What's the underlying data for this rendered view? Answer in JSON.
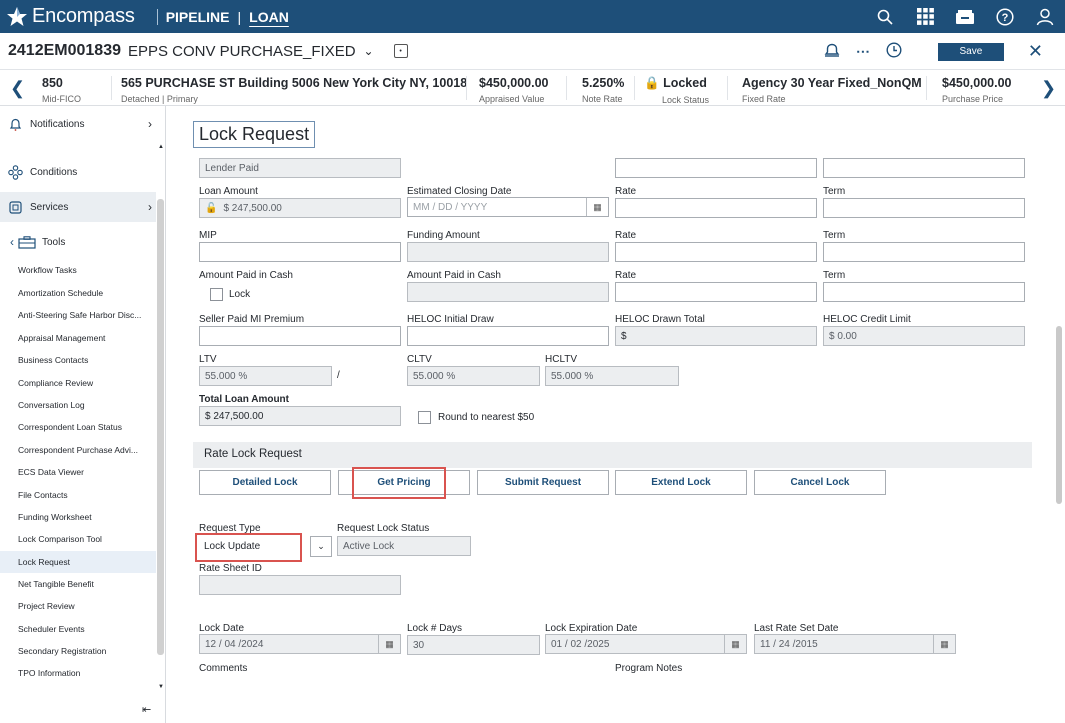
{
  "app": {
    "name": "Encompass",
    "nav_pipeline": "PIPELINE",
    "nav_loan": "LOAN"
  },
  "loan": {
    "number": "2412EM001839",
    "name": "EPPS CONV PURCHASE_FIXED",
    "save_label": "Save"
  },
  "strip": [
    {
      "value": "850",
      "label": "Mid-FICO"
    },
    {
      "value": "565 PURCHASE ST Building 5006 New York City NY, 10018",
      "label": "Detached | Primary"
    },
    {
      "value": "$450,000.00",
      "label": "Appraised Value"
    },
    {
      "value": "5.250%",
      "label": "Note Rate"
    },
    {
      "value": "Locked",
      "label": "Lock Status"
    },
    {
      "value": "Agency 30 Year Fixed_NonQM",
      "label": "Fixed Rate"
    },
    {
      "value": "$450,000.00",
      "label": "Purchase Price"
    }
  ],
  "sidebar": {
    "notifications": "Notifications",
    "conditions": "Conditions",
    "services": "Services",
    "tools": "Tools",
    "tool_items": [
      "Workflow Tasks",
      "Amortization Schedule",
      "Anti-Steering Safe Harbor Disc...",
      "Appraisal Management",
      "Business Contacts",
      "Compliance Review",
      "Conversation Log",
      "Correspondent Loan Status",
      "Correspondent Purchase Advi...",
      "ECS Data Viewer",
      "File Contacts",
      "Funding Worksheet",
      "Lock Comparison Tool",
      "Lock Request",
      "Net Tangible Benefit",
      "Project Review",
      "Scheduler Events",
      "Secondary Registration",
      "TPO Information"
    ]
  },
  "form": {
    "title": "Lock Request",
    "lender_paid": "Lender Paid",
    "loan_amount_label": "Loan Amount",
    "loan_amount": "$ 247,500.00",
    "est_closing_label": "Estimated Closing Date",
    "est_closing_placeholder": "MM / DD / YYYY",
    "rate_label": "Rate",
    "term_label": "Term",
    "mip_label": "MIP",
    "funding_amount_label": "Funding Amount",
    "amount_paid_cash_label": "Amount Paid in Cash",
    "lock_label": "Lock",
    "seller_paid_label": "Seller Paid MI Premium",
    "heloc_initial_label": "HELOC Initial Draw",
    "heloc_drawn_label": "HELOC Drawn Total",
    "heloc_drawn_value": "$",
    "heloc_credit_label": "HELOC Credit Limit",
    "heloc_credit_value": "$ 0.00",
    "ltv_label": "LTV",
    "ltv_value": "55.000 %",
    "ltv_sep": "/",
    "cltv_label": "CLTV",
    "cltv_value": "55.000 %",
    "hcltv_label": "HCLTV",
    "hcltv_value": "55.000 %",
    "total_loan_label": "Total Loan Amount",
    "total_loan_value": "$ 247,500.00",
    "round_label": "Round to nearest $50",
    "section_title": "Rate Lock Request",
    "buttons": {
      "detailed": "Detailed Lock",
      "pricing": "Get Pricing",
      "submit": "Submit Request",
      "extend": "Extend Lock",
      "cancel": "Cancel Lock"
    },
    "request_type_label": "Request Type",
    "request_type_value": "Lock Update",
    "request_status_label": "Request Lock Status",
    "request_status_value": "Active Lock",
    "rate_sheet_label": "Rate Sheet ID",
    "lock_date_label": "Lock Date",
    "lock_date_value": "12 / 04 /2024",
    "lock_days_label": "Lock # Days",
    "lock_days_value": "30",
    "lock_exp_label": "Lock Expiration Date",
    "lock_exp_value": "01 / 02 /2025",
    "last_rate_label": "Last Rate Set Date",
    "last_rate_value": "11 / 24 /2015",
    "comments_label": "Comments",
    "program_notes_label": "Program Notes"
  }
}
